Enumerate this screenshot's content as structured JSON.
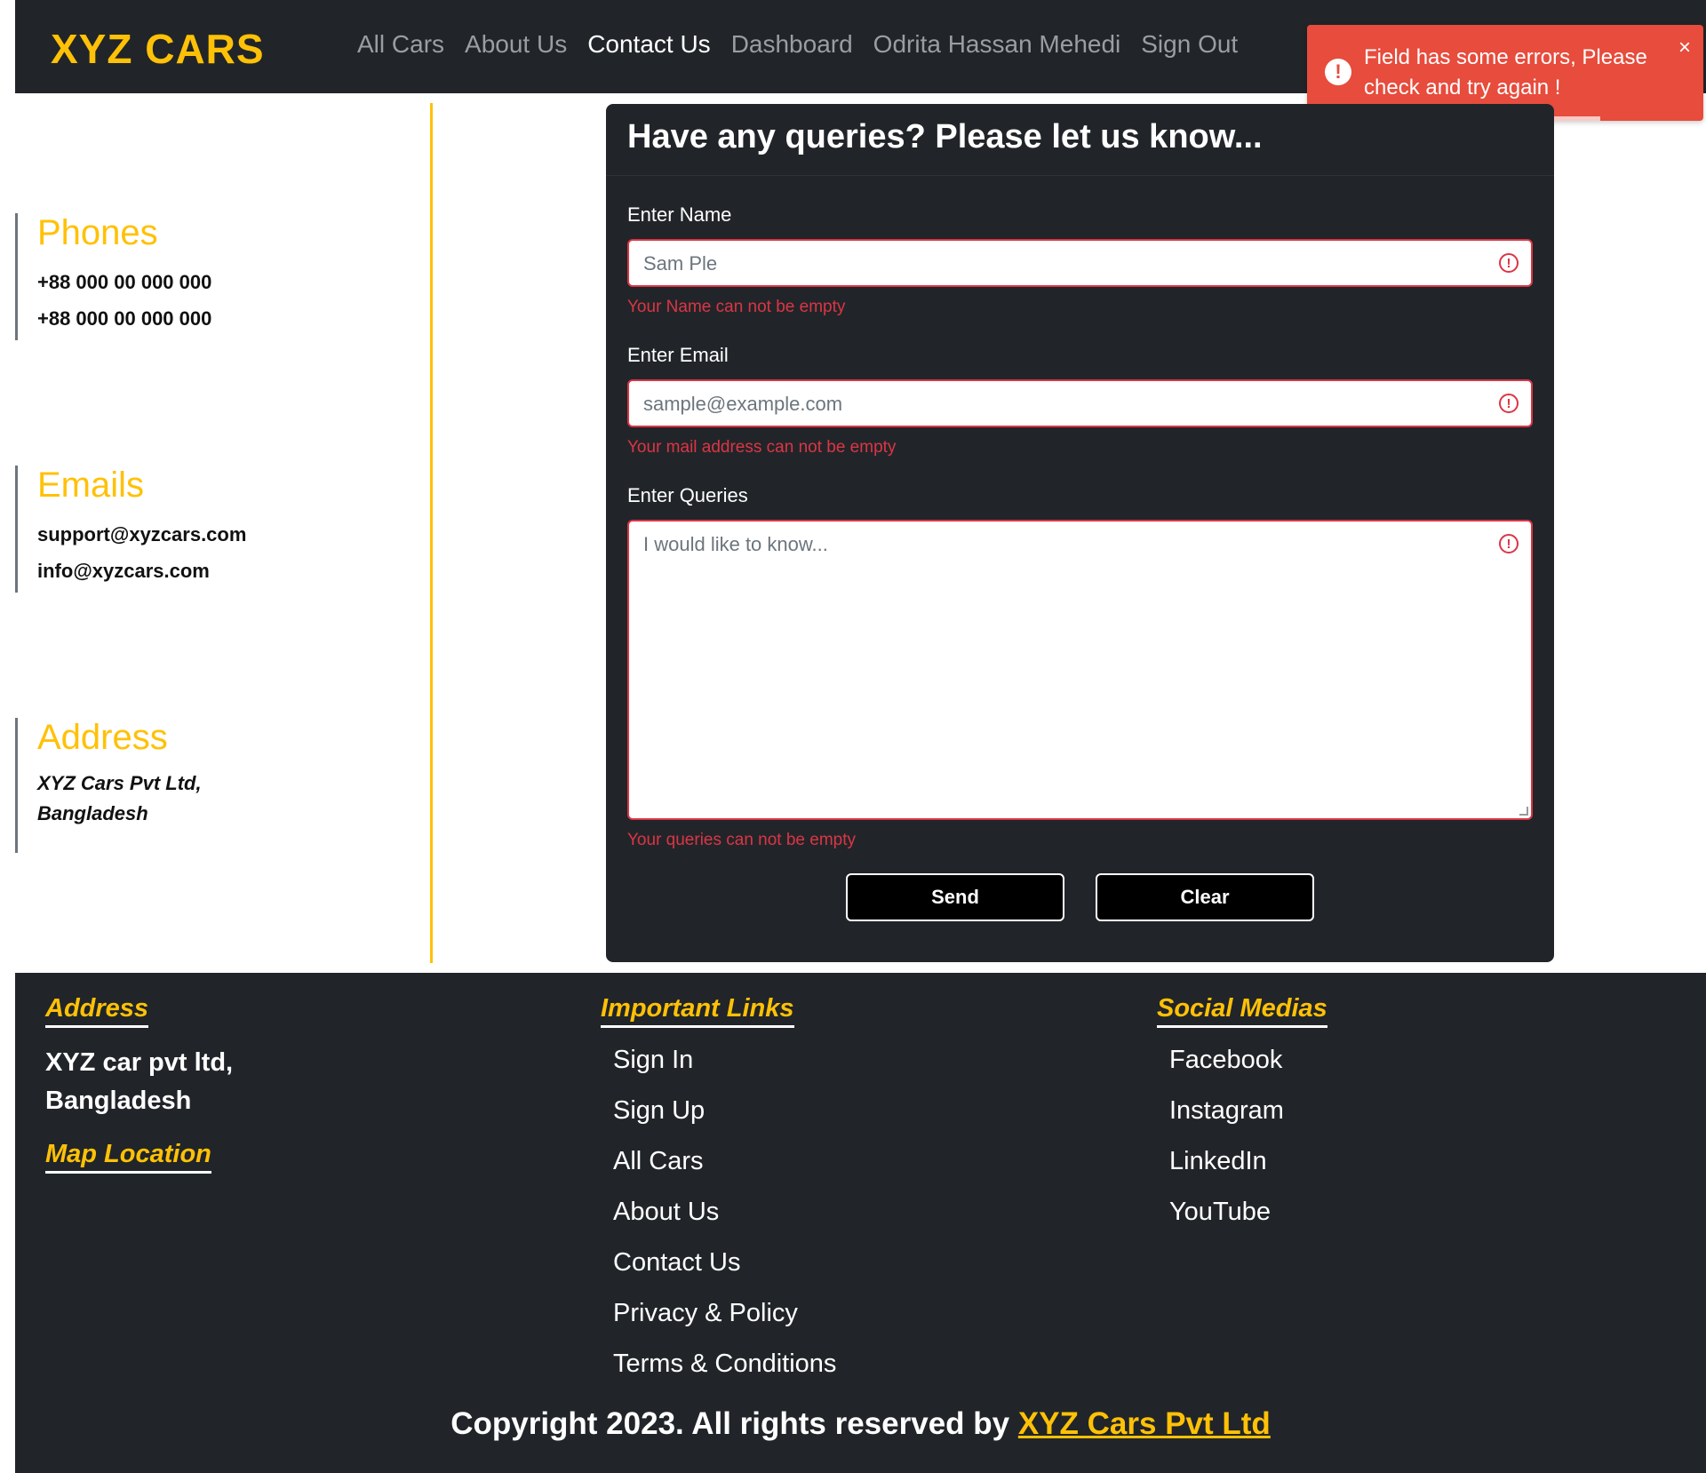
{
  "navbar": {
    "brand": "XYZ CARS",
    "links": [
      "All Cars",
      "About Us",
      "Contact Us",
      "Dashboard",
      "Odrita Hassan Mehedi",
      "Sign Out"
    ],
    "active": "Contact Us"
  },
  "toast": {
    "message": "Field has some errors, Please check and try again !",
    "icon": "!",
    "close": "×",
    "progress": 0.74
  },
  "contact_info": {
    "phones": {
      "title": "Phones",
      "items": [
        "+88 000 00 000 000",
        "+88 000 00 000 000"
      ]
    },
    "emails": {
      "title": "Emails",
      "items": [
        "support@xyzcars.com",
        "info@xyzcars.com"
      ]
    },
    "address": {
      "title": "Address",
      "lines": [
        "XYZ Cars Pvt Ltd,",
        "Bangladesh"
      ]
    }
  },
  "form": {
    "title": "Have any queries? Please let us know...",
    "name": {
      "label": "Enter Name",
      "placeholder": "Sam Ple",
      "error": "Your Name can not be empty"
    },
    "email": {
      "label": "Enter Email",
      "placeholder": "sample@example.com",
      "error": "Your mail address can not be empty"
    },
    "queries": {
      "label": "Enter Queries",
      "placeholder": "I would like to know...",
      "error": "Your queries can not be empty"
    },
    "send_label": "Send",
    "clear_label": "Clear",
    "error_icon": "!"
  },
  "footer": {
    "address_title": "Address",
    "address_lines": [
      "XYZ car pvt ltd,",
      "Bangladesh"
    ],
    "map_title": "Map Location",
    "links_title": "Important Links",
    "links": [
      "Sign In",
      "Sign Up",
      "All Cars",
      "About Us",
      "Contact Us",
      "Privacy & Policy",
      "Terms & Conditions"
    ],
    "social_title": "Social Medias",
    "social": [
      "Facebook",
      "Instagram",
      "LinkedIn",
      "YouTube"
    ],
    "copyright_prefix": "Copyright 2023. All rights reserved by ",
    "copyright_link": "XYZ Cars Pvt Ltd"
  },
  "colors": {
    "accent": "#ffc107",
    "dark": "#212529",
    "error": "#dc3545",
    "toast": "#e74c3c"
  }
}
